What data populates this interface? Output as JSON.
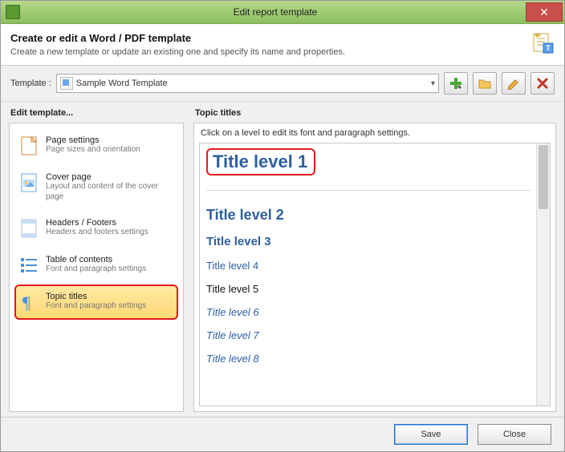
{
  "window": {
    "title": "Edit report template"
  },
  "header": {
    "heading": "Create or edit a Word / PDF template",
    "sub": "Create a new template or update an existing one and specify its name and properties."
  },
  "template": {
    "label": "Template :",
    "selected": "Sample Word Template"
  },
  "sidebar": {
    "heading": "Edit template...",
    "items": [
      {
        "title": "Page settings",
        "sub": "Page sizes and orientation"
      },
      {
        "title": "Cover page",
        "sub": "Layout and content of the cover page"
      },
      {
        "title": "Headers / Footers",
        "sub": "Headers and footers settings"
      },
      {
        "title": "Table of contents",
        "sub": "Font and paragraph settings"
      },
      {
        "title": "Topic titles",
        "sub": "Font and paragraph settings"
      }
    ]
  },
  "right": {
    "heading": "Topic titles",
    "hint": "Click on a level to edit its font and paragraph settings.",
    "levels": [
      "Title level 1",
      "Title level 2",
      "Title level 3",
      "Title level 4",
      "Title level 5",
      "Title level 6",
      "Title level 7",
      "Title level 8"
    ]
  },
  "footer": {
    "save": "Save",
    "close": "Close"
  }
}
